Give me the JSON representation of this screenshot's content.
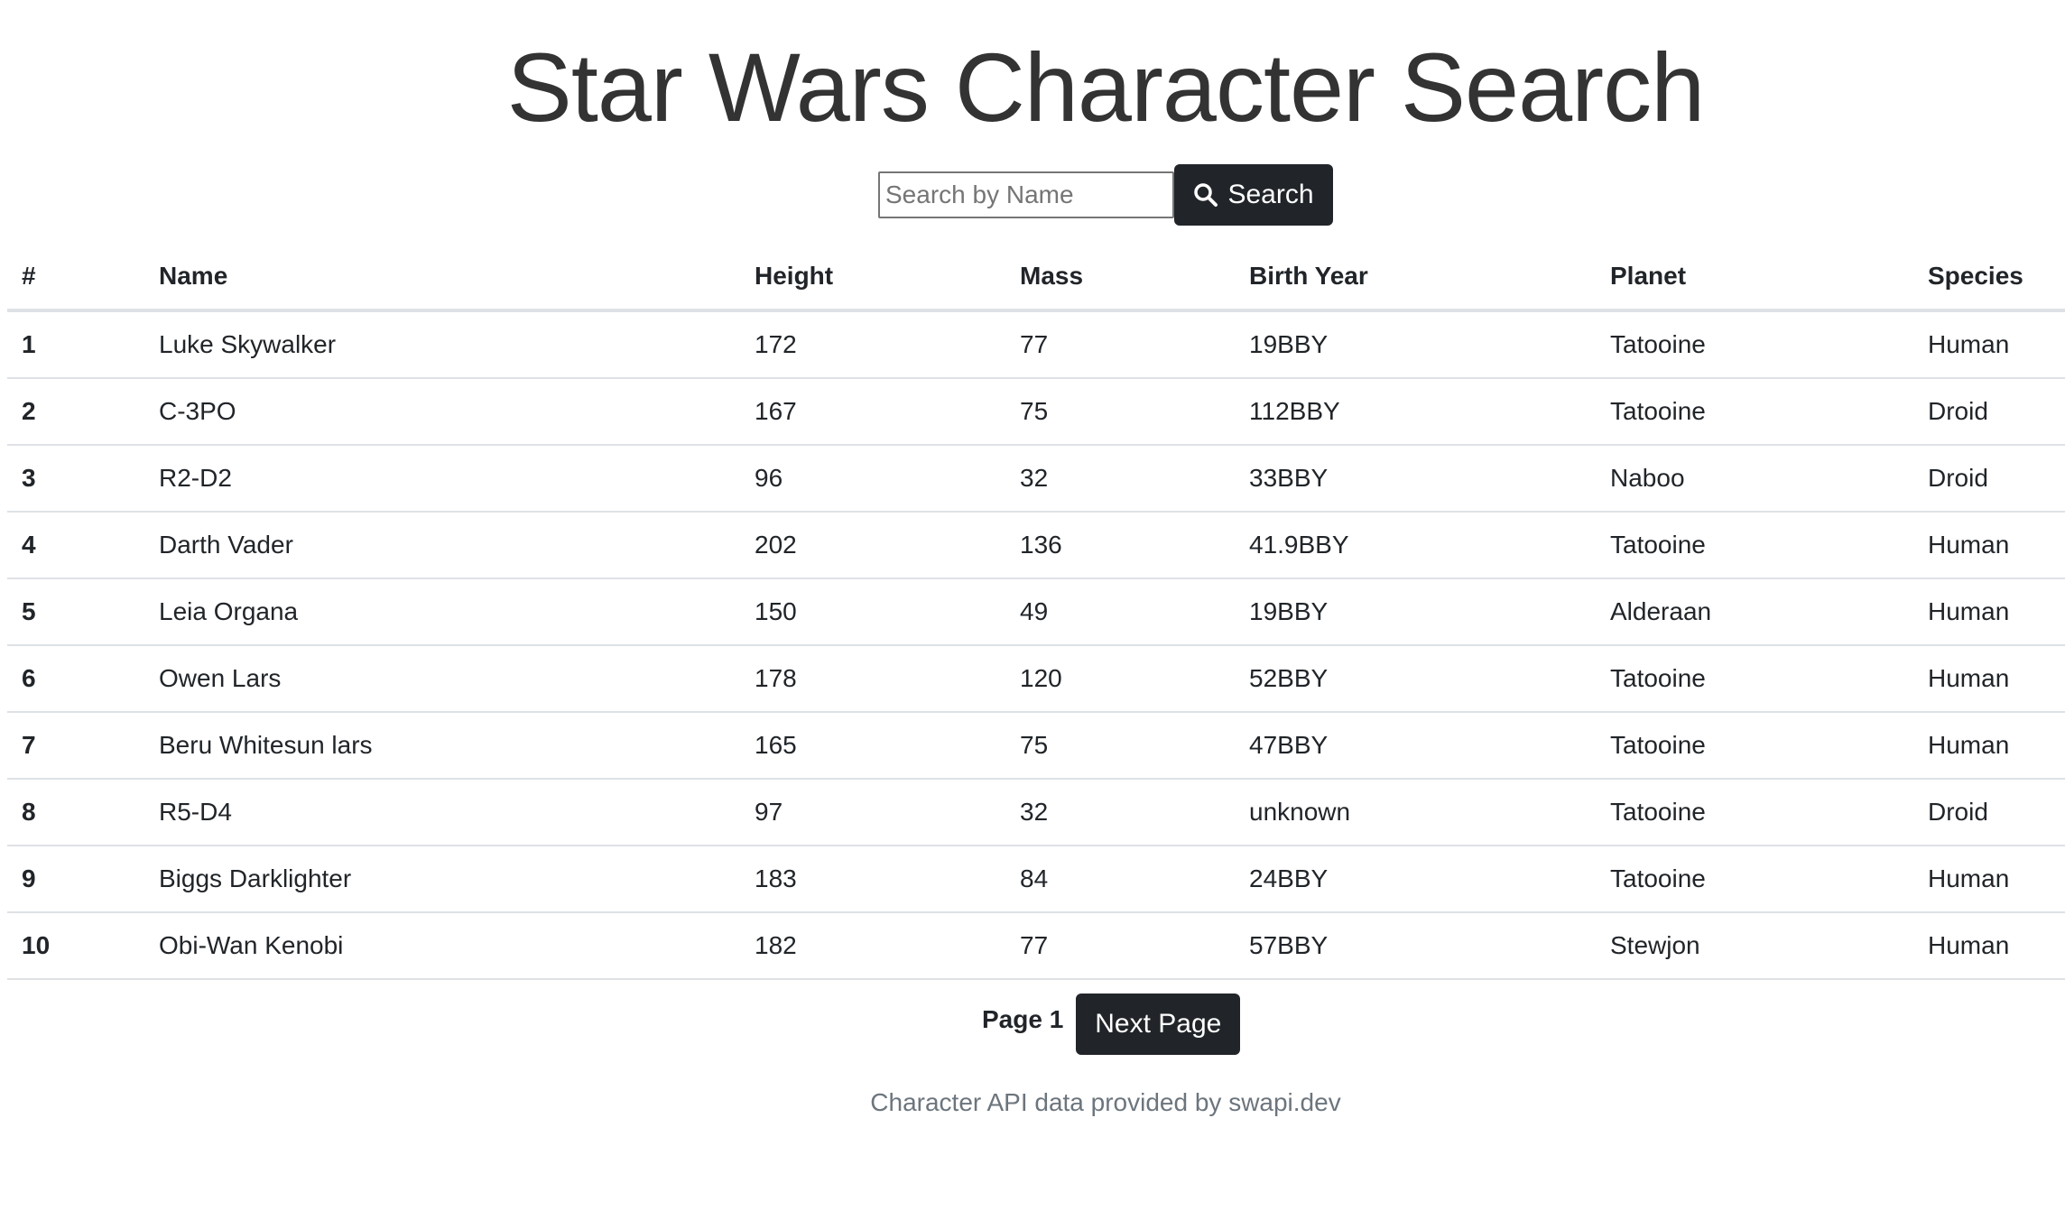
{
  "header": {
    "title": "Star Wars Character Search"
  },
  "search": {
    "placeholder": "Search by Name",
    "value": "",
    "button_label": "Search",
    "button_icon": "search-icon"
  },
  "table": {
    "columns": [
      "#",
      "Name",
      "Height",
      "Mass",
      "Birth Year",
      "Planet",
      "Species"
    ],
    "rows": [
      [
        "1",
        "Luke Skywalker",
        "172",
        "77",
        "19BBY",
        "Tatooine",
        "Human"
      ],
      [
        "2",
        "C-3PO",
        "167",
        "75",
        "112BBY",
        "Tatooine",
        "Droid"
      ],
      [
        "3",
        "R2-D2",
        "96",
        "32",
        "33BBY",
        "Naboo",
        "Droid"
      ],
      [
        "4",
        "Darth Vader",
        "202",
        "136",
        "41.9BBY",
        "Tatooine",
        "Human"
      ],
      [
        "5",
        "Leia Organa",
        "150",
        "49",
        "19BBY",
        "Alderaan",
        "Human"
      ],
      [
        "6",
        "Owen Lars",
        "178",
        "120",
        "52BBY",
        "Tatooine",
        "Human"
      ],
      [
        "7",
        "Beru Whitesun lars",
        "165",
        "75",
        "47BBY",
        "Tatooine",
        "Human"
      ],
      [
        "8",
        "R5-D4",
        "97",
        "32",
        "unknown",
        "Tatooine",
        "Droid"
      ],
      [
        "9",
        "Biggs Darklighter",
        "183",
        "84",
        "24BBY",
        "Tatooine",
        "Human"
      ],
      [
        "10",
        "Obi-Wan Kenobi",
        "182",
        "77",
        "57BBY",
        "Stewjon",
        "Human"
      ]
    ]
  },
  "pagination": {
    "page_label": "Page 1",
    "next_label": "Next Page"
  },
  "footer": {
    "text": "Character API data provided by swapi.dev"
  },
  "colors": {
    "button_bg": "#212529",
    "text": "#212529",
    "muted": "#6c757d",
    "border": "#dee2e6"
  }
}
